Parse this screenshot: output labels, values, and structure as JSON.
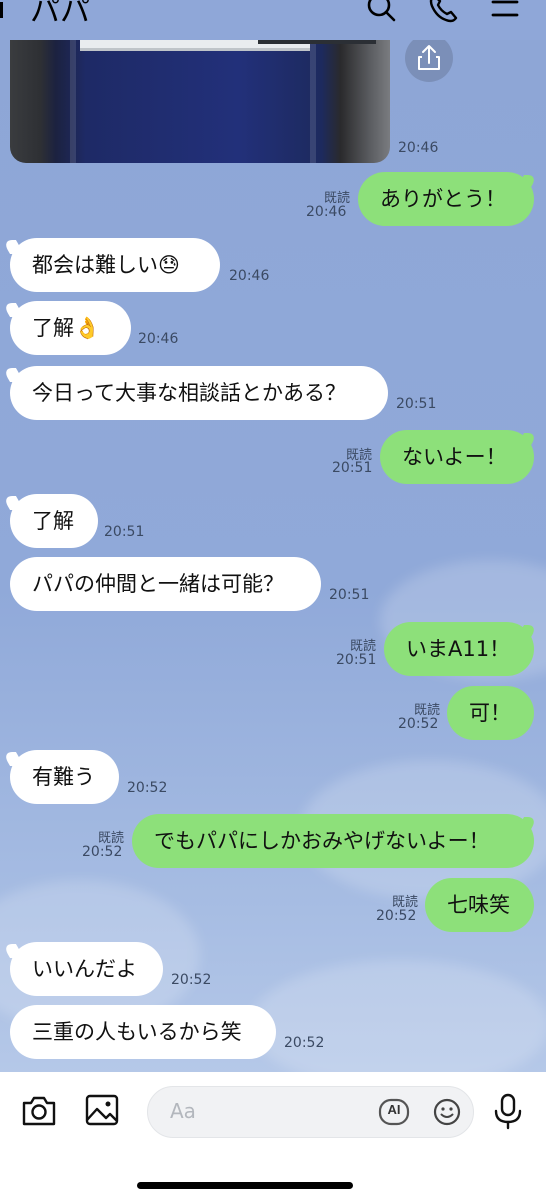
{
  "header": {
    "title": "パパ"
  },
  "image_message": {
    "time": "20:46"
  },
  "messages": [
    {
      "dir": "out",
      "text": "ありがとう！",
      "read": "既読",
      "time": "20:46"
    },
    {
      "dir": "in",
      "text": "都会は難しい😓",
      "time": "20:46"
    },
    {
      "dir": "in",
      "text": "了解👌",
      "time": "20:46"
    },
    {
      "dir": "in",
      "text": "今日って大事な相談話とかある？",
      "time": "20:51"
    },
    {
      "dir": "out",
      "text": "ないよー！",
      "read": "既読",
      "time": "20:51"
    },
    {
      "dir": "in",
      "text": "了解",
      "time": "20:51"
    },
    {
      "dir": "in",
      "text": "パパの仲間と一緒は可能？",
      "time": "20:51"
    },
    {
      "dir": "out",
      "text": "いまA11！",
      "read": "既読",
      "time": "20:51"
    },
    {
      "dir": "out",
      "text": "可！",
      "read": "既読",
      "time": "20:52"
    },
    {
      "dir": "in",
      "text": "有難う",
      "time": "20:52"
    },
    {
      "dir": "out",
      "text": "でもパパにしかおみやげないよー！",
      "read": "既読",
      "time": "20:52"
    },
    {
      "dir": "out",
      "text": "七味笑",
      "read": "既読",
      "time": "20:52"
    },
    {
      "dir": "in",
      "text": "いいんだよ",
      "time": "20:52"
    },
    {
      "dir": "in",
      "text": "三重の人もいるから笑",
      "time": "20:52"
    }
  ],
  "input": {
    "placeholder": "Aa",
    "ai_label": "AI"
  },
  "icons": {
    "search": "search-icon",
    "call": "phone-icon",
    "menu": "menu-icon",
    "share": "share-icon",
    "camera": "camera-icon",
    "image": "image-icon",
    "ai": "ai-icon",
    "emoji": "emoji-icon",
    "mic": "mic-icon"
  },
  "colors": {
    "bg": "#8fa7d8",
    "incoming": "#ffffff",
    "outgoing": "#8de07a"
  }
}
